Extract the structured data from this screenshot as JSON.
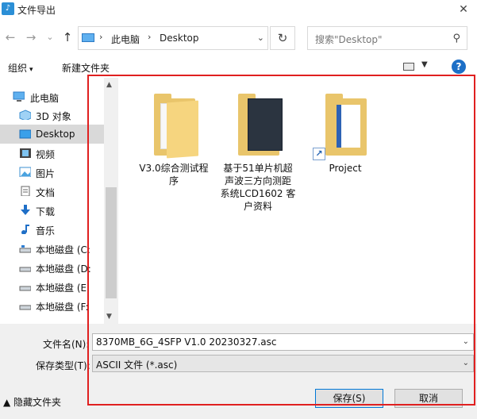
{
  "window": {
    "title": "文件导出",
    "close_symbol": "✕"
  },
  "nav": {
    "back_symbol": "←",
    "forward_symbol": "→",
    "recent_symbol": "⌄",
    "up_symbol": "↑",
    "breadcrumb": [
      "此电脑",
      "Desktop"
    ],
    "separator": "›",
    "dropdown_symbol": "⌄",
    "refresh_symbol": "↻",
    "search_placeholder": "搜索\"Desktop\"",
    "search_icon": "⚲"
  },
  "toolbar": {
    "organize": "组织",
    "new_folder": "新建文件夹",
    "help": "?"
  },
  "sidebar": {
    "items": [
      {
        "label": "此电脑",
        "icon": "monitor-icon"
      },
      {
        "label": "3D 对象",
        "icon": "cube-icon"
      },
      {
        "label": "Desktop",
        "icon": "desktop-icon"
      },
      {
        "label": "视频",
        "icon": "video-icon"
      },
      {
        "label": "图片",
        "icon": "picture-icon"
      },
      {
        "label": "文档",
        "icon": "document-icon"
      },
      {
        "label": "下载",
        "icon": "download-icon"
      },
      {
        "label": "音乐",
        "icon": "music-icon"
      },
      {
        "label": "本地磁盘 (C:",
        "icon": "drive-icon"
      },
      {
        "label": "本地磁盘 (D:",
        "icon": "drive-icon"
      },
      {
        "label": "本地磁盘 (E:",
        "icon": "drive-icon"
      },
      {
        "label": "本地磁盘 (F:",
        "icon": "drive-icon"
      }
    ],
    "selected_index": 2
  },
  "files": [
    {
      "name": "V3.0综合测试程序",
      "lines": [
        "V3.0综合测试程",
        "序"
      ],
      "type": "folder"
    },
    {
      "name": "基于51单片机超声波三方向测距系统LCD1602 客户资料",
      "lines": [
        "基于51单片机超",
        "声波三方向测距",
        "系统LCD1602 客",
        "户资料"
      ],
      "type": "folder-dark"
    },
    {
      "name": "Project",
      "lines": [
        "Project"
      ],
      "type": "folder-shortcut"
    }
  ],
  "form": {
    "filename_label": "文件名(N):",
    "filename_value": "8370MB_6G_4SFP V1.0 20230327.asc",
    "filetype_label": "保存类型(T):",
    "filetype_value": "ASCII 文件 (*.asc)",
    "hide_folders": "隐藏文件夹",
    "save_button": "保存(S)",
    "cancel_button": "取消"
  },
  "colors": {
    "highlight": "#e02020",
    "selected": "#d9d9d9",
    "accent": "#0078d7"
  }
}
